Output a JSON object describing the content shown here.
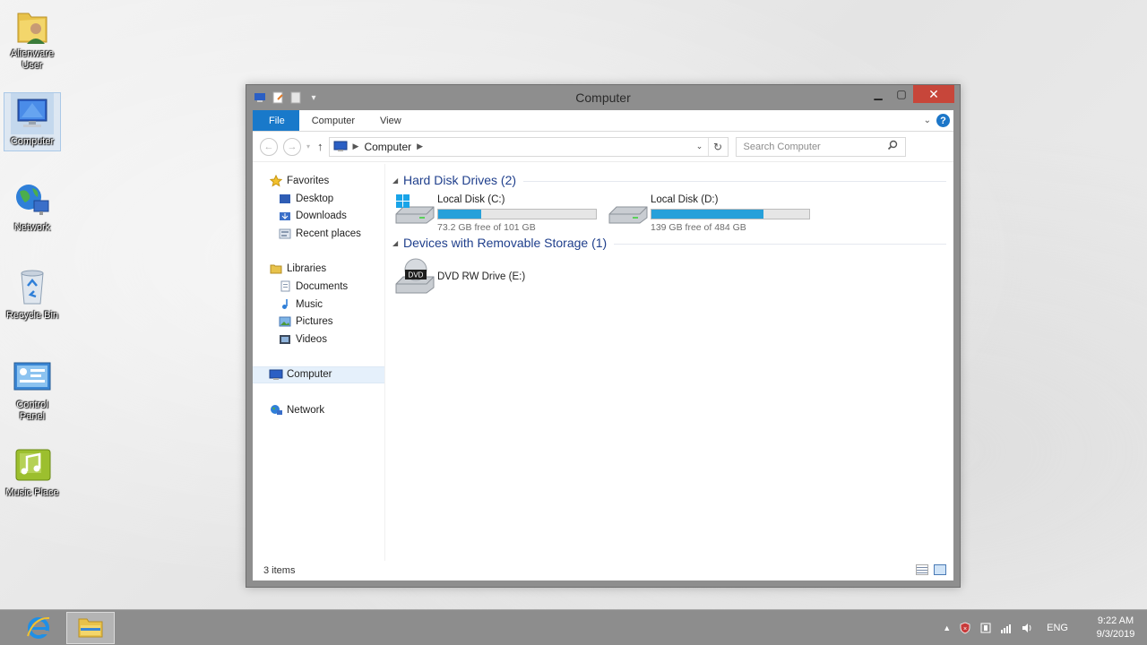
{
  "desktop": {
    "icons": [
      {
        "label_line1": "Alienware",
        "label_line2": "User",
        "icon": "user-folder-icon"
      },
      {
        "label_line1": "Computer",
        "label_line2": "",
        "icon": "computer-icon"
      },
      {
        "label_line1": "Network",
        "label_line2": "",
        "icon": "network-globe-icon"
      },
      {
        "label_line1": "Recycle Bin",
        "label_line2": "",
        "icon": "recycle-bin-icon"
      },
      {
        "label_line1": "Control",
        "label_line2": "Panel",
        "icon": "control-panel-icon"
      },
      {
        "label_line1": "Music Place",
        "label_line2": "",
        "icon": "music-place-icon"
      }
    ]
  },
  "window": {
    "title": "Computer",
    "ribbon_tabs": {
      "file": "File",
      "computer": "Computer",
      "view": "View"
    },
    "address": {
      "location": "Computer"
    },
    "search": {
      "placeholder": "Search Computer"
    },
    "nav": {
      "favorites": "Favorites",
      "desktop": "Desktop",
      "downloads": "Downloads",
      "recent": "Recent places",
      "libraries": "Libraries",
      "documents": "Documents",
      "music": "Music",
      "pictures": "Pictures",
      "videos": "Videos",
      "computer": "Computer",
      "network": "Network"
    },
    "groups": {
      "hdd": "Hard Disk Drives (2)",
      "removable": "Devices with Removable Storage (1)"
    },
    "drives": [
      {
        "name": "Local Disk (C:)",
        "free_text": "73.2 GB free of 101 GB",
        "used_fraction": 0.275
      },
      {
        "name": "Local Disk (D:)",
        "free_text": "139 GB free of 484 GB",
        "used_fraction": 0.713
      }
    ],
    "devices": [
      {
        "name": "DVD RW Drive (E:)",
        "icon_label": "DVD"
      }
    ],
    "status": "3 items"
  },
  "taskbar": {
    "language": "ENG",
    "time": "9:22 AM",
    "date": "9/3/2019"
  },
  "colors": {
    "accent": "#1979ca",
    "drive_fill": "#26a0da",
    "close": "#c7463a"
  }
}
